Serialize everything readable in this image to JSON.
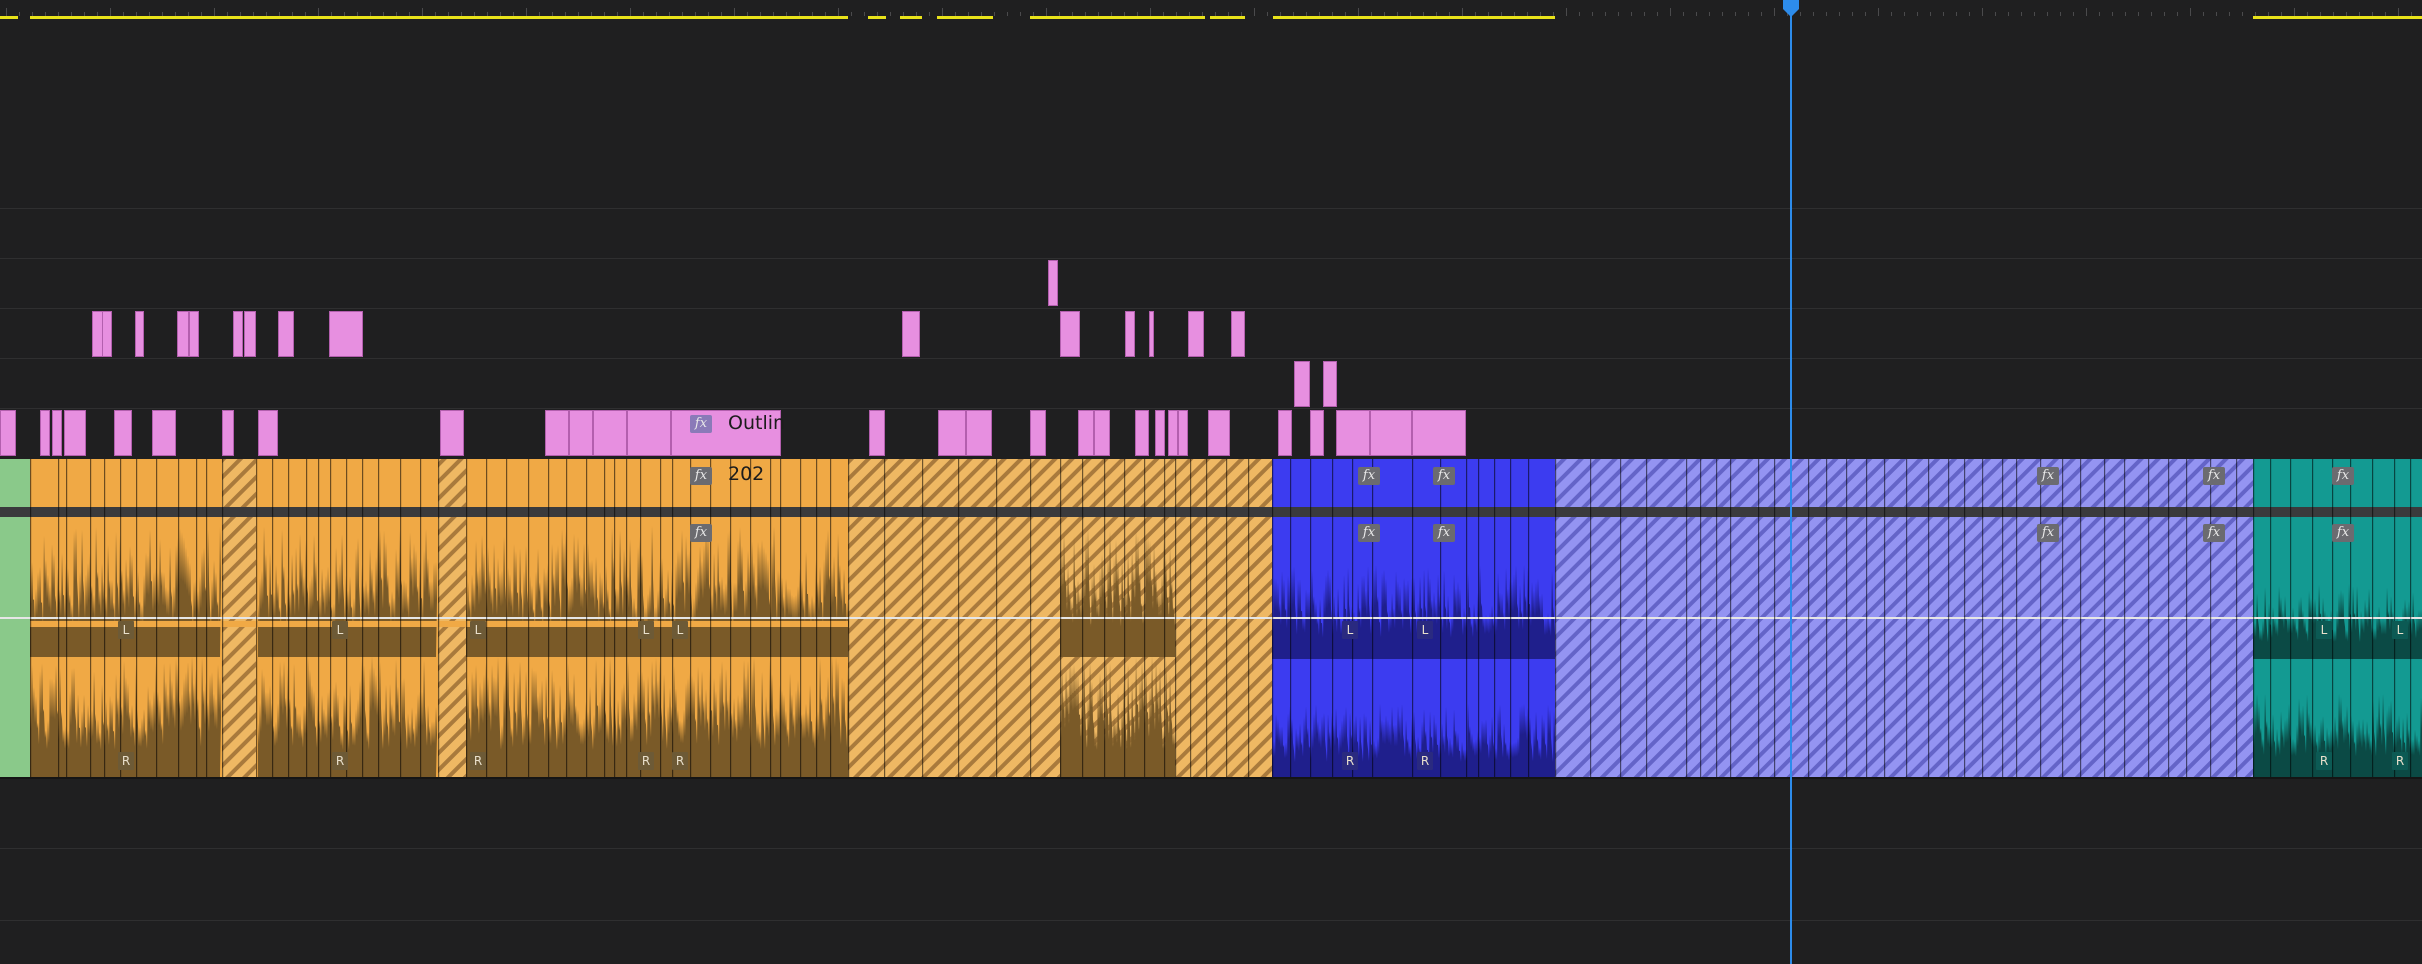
{
  "timeline": {
    "video_clip_title": "Outlin",
    "audio_clip_title": "202",
    "fx_badge": "fx",
    "channel_left": "L",
    "channel_right": "R"
  },
  "colors": {
    "background": "#1f1f20",
    "playhead": "#2d8ceb",
    "in_out_marker": "#e8e21a",
    "video_clip": "#e78fe0",
    "audio_orange": "#f0a945",
    "audio_orange_wave": "#7a5a28",
    "audio_blue": "#3c3cf0",
    "audio_blue_wave": "#1f1f8c",
    "audio_periwinkle": "#8f8ff0",
    "audio_teal": "#139a92",
    "audio_teal_wave": "#0b4a45",
    "audio_green": "#8ac98a"
  },
  "icons": {
    "fx_badge": "fx-icon",
    "playhead": "playhead-marker-icon"
  }
}
